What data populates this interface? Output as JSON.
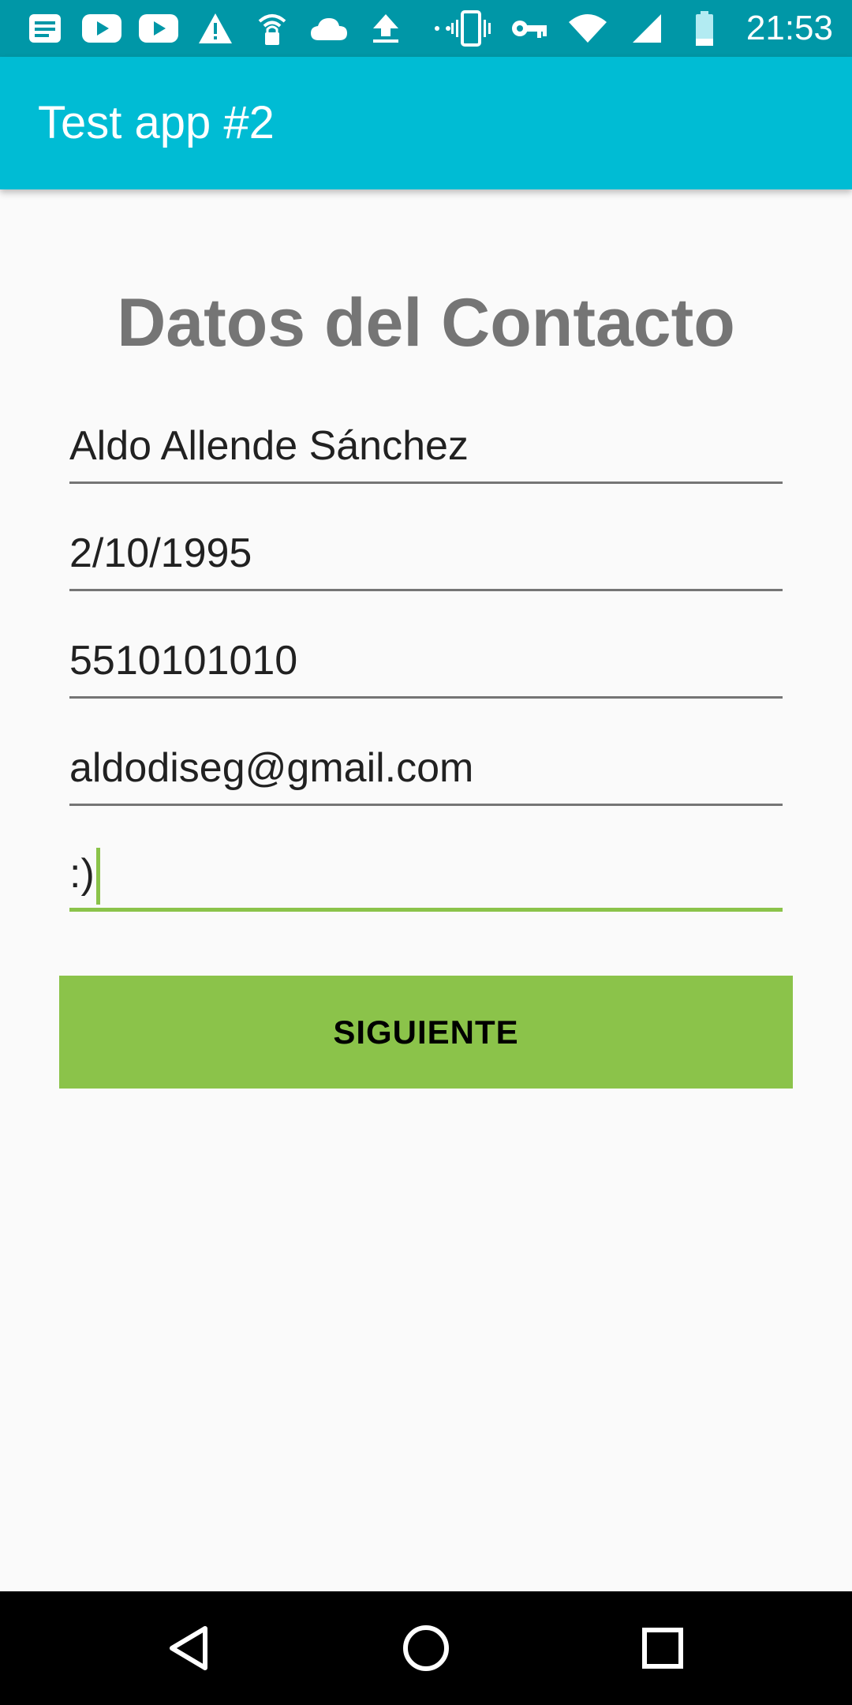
{
  "status_bar": {
    "time": "21:53",
    "icons_left": [
      "news-icon",
      "youtube-icon",
      "youtube-icon",
      "warning-icon",
      "wifi-lock-icon",
      "cloud-icon",
      "upload-icon",
      "more-dots-icon"
    ],
    "icons_right": [
      "vibrate-icon",
      "vpn-key-icon",
      "wifi-icon",
      "signal-icon",
      "battery-icon"
    ]
  },
  "app_bar": {
    "title": "Test app #2"
  },
  "form": {
    "heading": "Datos del Contacto",
    "fields": [
      {
        "name": "full-name-field",
        "value": "Aldo Allende Sánchez"
      },
      {
        "name": "birth-date-field",
        "value": "2/10/1995"
      },
      {
        "name": "phone-field",
        "value": "5510101010"
      },
      {
        "name": "email-field",
        "value": "aldodiseg@gmail.com"
      },
      {
        "name": "description-field",
        "value": ":)"
      }
    ],
    "next_button_label": "SIGUIENTE"
  },
  "nav_bar": {
    "buttons": [
      "back-icon",
      "home-icon",
      "recents-icon"
    ]
  },
  "colors": {
    "status_bar": "#0097a7",
    "app_bar": "#00bcd4",
    "accent": "#8bc34a",
    "heading": "#757575",
    "background": "#fafafa"
  }
}
